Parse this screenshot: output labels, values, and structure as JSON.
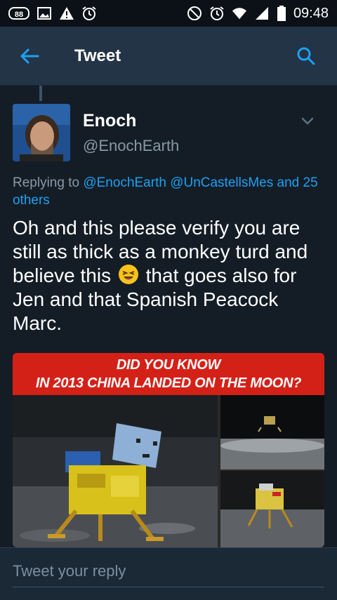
{
  "status_bar": {
    "notification_count": "88",
    "time": "09:48",
    "icons_left": [
      "notification-badge-icon",
      "image-icon",
      "warning-icon",
      "alarm-icon"
    ],
    "icons_right": [
      "do-not-disturb-icon",
      "alarm-icon",
      "wifi-icon",
      "signal-icon",
      "battery-icon"
    ]
  },
  "header": {
    "title": "Tweet",
    "back_icon": "arrow-left-icon",
    "search_icon": "search-icon",
    "accent": "#1da1f2"
  },
  "tweet": {
    "author_name": "Enoch",
    "author_handle": "@EnochEarth",
    "replying_prefix": "Replying to",
    "replying_to": "@EnochEarth @UnCastellsMes and 25 others",
    "text_before_emoji": "Oh and this please verify you are still as thick as a monkey turd and believe this",
    "emoji": "grinning-squinting-face-emoji",
    "text_after_emoji": "that goes also for Jen and that Spanish Peacock Marc.",
    "media": {
      "banner_line1": "DID YOU KNOW",
      "banner_line2": "IN 2013 CHINA LANDED ON THE MOON?"
    }
  },
  "reply": {
    "placeholder": "Tweet your reply"
  }
}
